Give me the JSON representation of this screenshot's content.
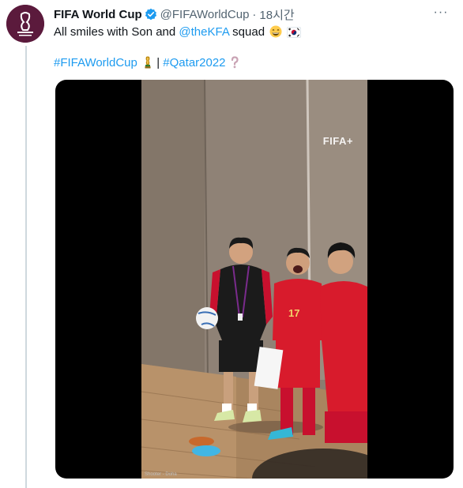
{
  "tweet": {
    "author_name": "FIFA World Cup",
    "handle": "@FIFAWorldCup",
    "separator": "·",
    "time": "18시간",
    "text_before": "All smiles with Son and ",
    "mention": "@theKFA",
    "text_after": " squad",
    "hashtag1": "#FIFAWorldCup",
    "hashtag_separator": "|",
    "hashtag2": "#Qatar2022",
    "more_label": "···"
  },
  "media": {
    "watermark": "FIFA+",
    "caption": "Shooter - Doha"
  },
  "colors": {
    "link": "#1d9bf0",
    "verified": "#1d9bf0",
    "avatar_bg": "#5b1a3c",
    "text": "#0f1419",
    "secondary": "#536471"
  },
  "icons": {
    "verified": "verified-badge-icon",
    "more": "more-options-icon",
    "emoji1": "grinning-face-emoji",
    "emoji2": "south-korea-flag-emoji",
    "emoji3": "trophy-emoji",
    "emoji4": "question-mark-emoji"
  }
}
